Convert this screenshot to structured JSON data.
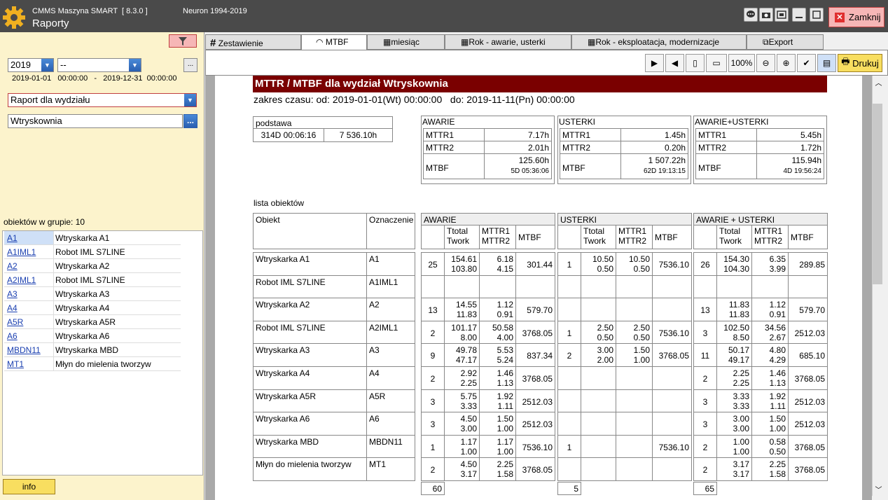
{
  "titlebar": {
    "app_title": "CMMS Maszyna SMART  [ 8.3.0 ]",
    "neuron": "Neuron 1994-2019",
    "page_title": "Raporty",
    "close_label": "Zamknij"
  },
  "filters": {
    "year": "2019",
    "month": "--",
    "range": "2019-01-01   00:00:00   -   2019-12-31  00:00:00",
    "raport": "Raport dla wydziału",
    "wydzial": "Wtryskownia",
    "dots": "..."
  },
  "list": {
    "count_label": "obiektów w grupie: 10",
    "items": [
      {
        "code": "A1",
        "name": "Wtryskarka A1"
      },
      {
        "code": "A1IML1",
        "name": "Robot IML S7LINE"
      },
      {
        "code": "A2",
        "name": "Wtryskarka A2"
      },
      {
        "code": "A2IML1",
        "name": "Robot IML S7LINE"
      },
      {
        "code": "A3",
        "name": "Wtryskarka A3"
      },
      {
        "code": "A4",
        "name": "Wtryskarka A4"
      },
      {
        "code": "A5R",
        "name": "Wtryskarka A5R"
      },
      {
        "code": "A6",
        "name": "Wtryskarka A6"
      },
      {
        "code": "MBDN11",
        "name": "Wtryskarka MBD"
      },
      {
        "code": "MT1",
        "name": "Młyn do mielenia tworzyw"
      }
    ]
  },
  "info_label": "info",
  "tabs": [
    "Zestawienie",
    "MTBF",
    "miesiąc",
    "Rok - awarie, usterki",
    "Rok - eksploatacja, modernizacje",
    "Export"
  ],
  "toolbar": {
    "zoom": "100%",
    "print": "Drukuj"
  },
  "report": {
    "title": "MTTR / MTBF dla wydział Wtryskownia",
    "zakres": "zakres czasu: od: 2019-01-01(Wt) 00:00:00   do: 2019-11-11(Pn) 00:00:00",
    "podstawa": {
      "label": "podstawa",
      "time": "314D 00:06:16",
      "hours": "7 536.10h"
    },
    "summary": [
      {
        "title": "AWARIE",
        "mttr1": "7.17h",
        "mttr2": "2.01h",
        "mtbf": "125.60h",
        "mtbf2": "5D 05:36:06"
      },
      {
        "title": "USTERKI",
        "mttr1": "1.45h",
        "mttr2": "0.20h",
        "mtbf": "1 507.22h",
        "mtbf2": "62D 19:13:15"
      },
      {
        "title": "AWARIE+USTERKI",
        "mttr1": "5.45h",
        "mttr2": "1.72h",
        "mtbf": "115.94h",
        "mtbf2": "4D 19:56:24"
      }
    ],
    "labels": {
      "mttr1": "MTTR1",
      "mttr2": "MTTR2",
      "mtbf": "MTBF",
      "lista": "lista obiektów",
      "obiekt": "Obiekt",
      "oznaczenie": "Oznaczenie",
      "ttotal": "Ttotal",
      "twork": "Twork",
      "g1": "AWARIE",
      "g2": "USTERKI",
      "g3": "AWARIE + USTERKI"
    },
    "rows": [
      {
        "obj": "Wtryskarka A1",
        "code": "A1",
        "a": [
          "25",
          "154.61",
          "103.80",
          "6.18",
          "4.15",
          "301.44"
        ],
        "u": [
          "1",
          "10.50",
          "0.50",
          "10.50",
          "0.50",
          "7536.10"
        ],
        "s": [
          "26",
          "154.30",
          "104.30",
          "6.35",
          "3.99",
          "289.85"
        ]
      },
      {
        "obj": "Robot IML S7LINE",
        "code": "A1IML1",
        "a": [
          "",
          "",
          "",
          "",
          "",
          ""
        ],
        "u": [
          "",
          "",
          "",
          "",
          "",
          ""
        ],
        "s": [
          "",
          "",
          "",
          "",
          "",
          ""
        ]
      },
      {
        "obj": "Wtryskarka A2",
        "code": "A2",
        "a": [
          "13",
          "14.55",
          "11.83",
          "1.12",
          "0.91",
          "579.70"
        ],
        "u": [
          "",
          "",
          "",
          "",
          "",
          ""
        ],
        "s": [
          "13",
          "11.83",
          "11.83",
          "1.12",
          "0.91",
          "579.70"
        ]
      },
      {
        "obj": "Robot IML S7LINE",
        "code": "A2IML1",
        "a": [
          "2",
          "101.17",
          "8.00",
          "50.58",
          "4.00",
          "3768.05"
        ],
        "u": [
          "1",
          "2.50",
          "0.50",
          "2.50",
          "0.50",
          "7536.10"
        ],
        "s": [
          "3",
          "102.50",
          "8.50",
          "34.56",
          "2.67",
          "2512.03"
        ]
      },
      {
        "obj": "Wtryskarka A3",
        "code": "A3",
        "a": [
          "9",
          "49.78",
          "47.17",
          "5.53",
          "5.24",
          "837.34"
        ],
        "u": [
          "2",
          "3.00",
          "2.00",
          "1.50",
          "1.00",
          "3768.05"
        ],
        "s": [
          "11",
          "50.17",
          "49.17",
          "4.80",
          "4.29",
          "685.10"
        ]
      },
      {
        "obj": "Wtryskarka A4",
        "code": "A4",
        "a": [
          "2",
          "2.92",
          "2.25",
          "1.46",
          "1.13",
          "3768.05"
        ],
        "u": [
          "",
          "",
          "",
          "",
          "",
          ""
        ],
        "s": [
          "2",
          "2.25",
          "2.25",
          "1.46",
          "1.13",
          "3768.05"
        ]
      },
      {
        "obj": "Wtryskarka A5R",
        "code": "A5R",
        "a": [
          "3",
          "5.75",
          "3.33",
          "1.92",
          "1.11",
          "2512.03"
        ],
        "u": [
          "",
          "",
          "",
          "",
          "",
          ""
        ],
        "s": [
          "3",
          "3.33",
          "3.33",
          "1.92",
          "1.11",
          "2512.03"
        ]
      },
      {
        "obj": "Wtryskarka A6",
        "code": "A6",
        "a": [
          "3",
          "4.50",
          "3.00",
          "1.50",
          "1.00",
          "2512.03"
        ],
        "u": [
          "",
          "",
          "",
          "",
          "",
          ""
        ],
        "s": [
          "3",
          "3.00",
          "3.00",
          "1.50",
          "1.00",
          "2512.03"
        ]
      },
      {
        "obj": "Wtryskarka MBD",
        "code": "MBDN11",
        "a": [
          "1",
          "1.17",
          "1.00",
          "1.17",
          "1.00",
          "7536.10"
        ],
        "u": [
          "1",
          "",
          "",
          "",
          "",
          "7536.10"
        ],
        "s": [
          "2",
          "1.00",
          "1.00",
          "0.58",
          "0.50",
          "3768.05"
        ]
      },
      {
        "obj": "Młyn do mielenia tworzyw",
        "code": "MT1",
        "a": [
          "2",
          "4.50",
          "3.17",
          "2.25",
          "1.58",
          "3768.05"
        ],
        "u": [
          "",
          "",
          "",
          "",
          "",
          ""
        ],
        "s": [
          "2",
          "3.17",
          "3.17",
          "2.25",
          "1.58",
          "3768.05"
        ]
      }
    ],
    "totals": [
      "60",
      "5",
      "65"
    ]
  }
}
